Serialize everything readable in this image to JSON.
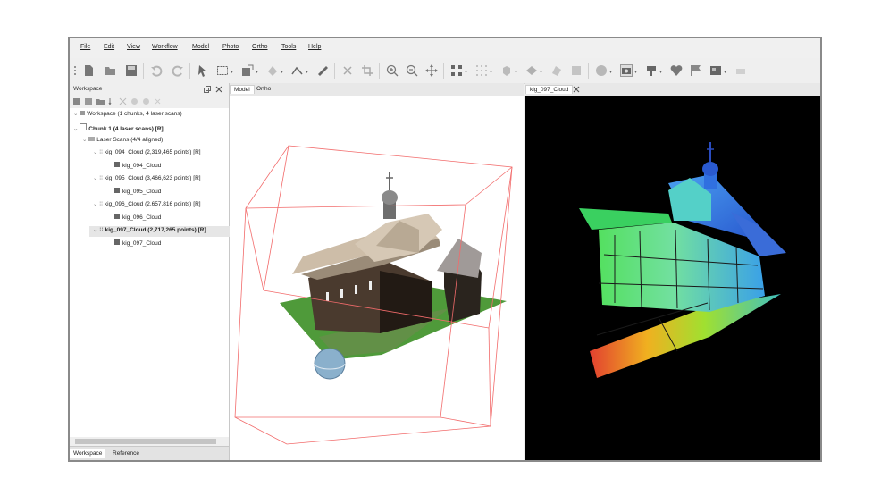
{
  "menu": [
    "File",
    "Edit",
    "View",
    "Workflow",
    "Model",
    "Photo",
    "Ortho",
    "Tools",
    "Help"
  ],
  "toolbar_icons": [
    "new-icon",
    "open-icon",
    "save-icon",
    "undo-icon",
    "redo-icon",
    "select-icon",
    "rect-select-icon",
    "resize-region-icon",
    "rotate-region-icon",
    "ruler-icon",
    "polyline-icon",
    "delete-icon",
    "crop-icon",
    "zoom-in-icon",
    "zoom-out-icon",
    "move-icon",
    "grid-points-icon",
    "dense-cloud-icon",
    "model-solid-icon",
    "model-textured-icon",
    "mask-icon",
    "tiled-model-icon",
    "dem-icon",
    "camera-icon",
    "shapes-icon",
    "markers-icon",
    "flag-icon",
    "ortho-icon",
    "reset-view-icon"
  ],
  "workspace": {
    "title": "Workspace",
    "tabs": [
      "Workspace",
      "Reference"
    ],
    "tree": [
      {
        "label": "Workspace (1 chunks, 4 laser scans)",
        "level": 0,
        "selected": false,
        "icon": "workspace-icon"
      },
      {
        "label": "Chunk 1 (4 laser scans) [R]",
        "level": 0,
        "selected": false,
        "bold": true,
        "icon": "chunk-icon"
      },
      {
        "label": "Laser Scans (4/4 aligned)",
        "level": 1,
        "selected": false,
        "icon": "folder-icon"
      },
      {
        "label": "kig_094_Cloud (2,319,465 points) [R]",
        "level": 2,
        "selected": false,
        "icon": "point-cloud-icon"
      },
      {
        "label": "kig_094_Cloud",
        "level": 3,
        "selected": false,
        "icon": "image-icon"
      },
      {
        "label": "kig_095_Cloud (3,466,623 points) [R]",
        "level": 2,
        "selected": false,
        "icon": "point-cloud-icon"
      },
      {
        "label": "kig_095_Cloud",
        "level": 3,
        "selected": false,
        "icon": "image-icon"
      },
      {
        "label": "kig_096_Cloud (2,657,816 points) [R]",
        "level": 2,
        "selected": false,
        "icon": "point-cloud-icon"
      },
      {
        "label": "kig_096_Cloud",
        "level": 3,
        "selected": false,
        "icon": "image-icon"
      },
      {
        "label": "kig_097_Cloud (2,717,265 points) [R]",
        "level": 2,
        "selected": true,
        "icon": "point-cloud-icon"
      },
      {
        "label": "kig_097_Cloud",
        "level": 3,
        "selected": false,
        "icon": "image-icon"
      }
    ]
  },
  "views": {
    "model_tabs": [
      "Model",
      "Ortho"
    ],
    "cloud_tab": "kig_097_Cloud"
  },
  "colors": {
    "selection": "#e6e6e6",
    "region_box": "#f26b6b",
    "cloud_bg": "#000000"
  }
}
